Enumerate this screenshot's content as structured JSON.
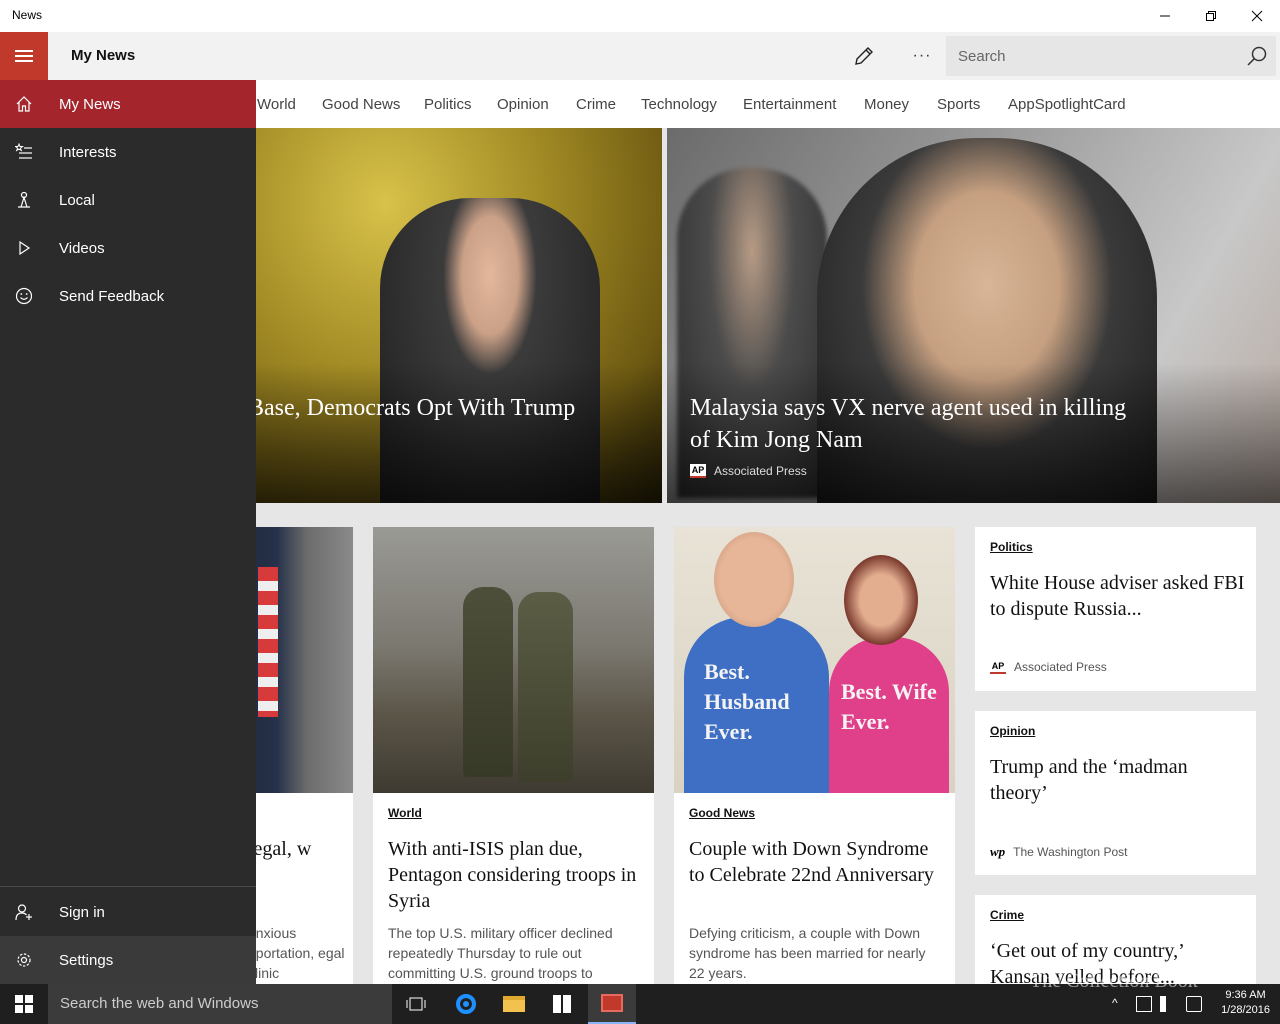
{
  "window": {
    "title": "News",
    "minimize_label": "Minimize",
    "maximize_label": "Restore",
    "close_label": "Close"
  },
  "header": {
    "page_title": "My News",
    "search_placeholder": "Search",
    "more_glyph": "···"
  },
  "tabs": [
    "World",
    "Good News",
    "Politics",
    "Opinion",
    "Crime",
    "Technology",
    "Entertainment",
    "Money",
    "Sports",
    "AppSpotlightCard"
  ],
  "nav": {
    "items": [
      {
        "label": "My News",
        "icon": "home-icon"
      },
      {
        "label": "Interests",
        "icon": "interests-icon"
      },
      {
        "label": "Local",
        "icon": "local-icon"
      },
      {
        "label": "Videos",
        "icon": "play-icon"
      },
      {
        "label": "Send Feedback",
        "icon": "smiley-icon"
      }
    ],
    "footer": [
      {
        "label": "Sign in",
        "icon": "person-add-icon"
      },
      {
        "label": "Settings",
        "icon": "gear-icon"
      }
    ]
  },
  "hero": [
    {
      "headline": "Base, Democrats Opt With Trump",
      "source": ""
    },
    {
      "headline": "Malaysia says VX nerve agent used in killing of Kim Jong Nam",
      "source": "Associated Press",
      "source_logo": "AP"
    }
  ],
  "cards": [
    {
      "category": "",
      "title": "legal, w",
      "desc": "anxious eportation, egal clinic"
    },
    {
      "category": "World",
      "title": "With anti-ISIS plan due, Pentagon considering troops in Syria",
      "desc": "The top U.S. military officer declined repeatedly Thursday to rule out committing U.S. ground troops to"
    },
    {
      "category": "Good News",
      "title": "Couple with Down Syndrome to Celebrate 22nd Anniversary",
      "desc": "Defying criticism, a couple with Down syndrome has been married for nearly 22 years.",
      "shirt_left": "Best. Husband Ever.",
      "shirt_right": "Best. Wife Ever."
    }
  ],
  "side_cards": [
    {
      "category": "Politics",
      "title": "White House adviser asked FBI to dispute Russia...",
      "source": "Associated Press",
      "source_logo": "AP"
    },
    {
      "category": "Opinion",
      "title": "Trump and the ‘madman theory’",
      "source": "The Washington Post",
      "source_logo": "wp"
    },
    {
      "category": "Crime",
      "title": "‘Get out of my country,’ Kansan yelled before..."
    }
  ],
  "taskbar": {
    "search_placeholder": "Search the web and Windows",
    "time": "9:36 AM",
    "date": "1/28/2016",
    "watermark": "The Collection Book"
  },
  "colors": {
    "accent": "#c0392b",
    "nav_active": "#a4262c",
    "nav_bg": "#2b2b2b",
    "taskbar_bg": "#1f1f1f"
  }
}
